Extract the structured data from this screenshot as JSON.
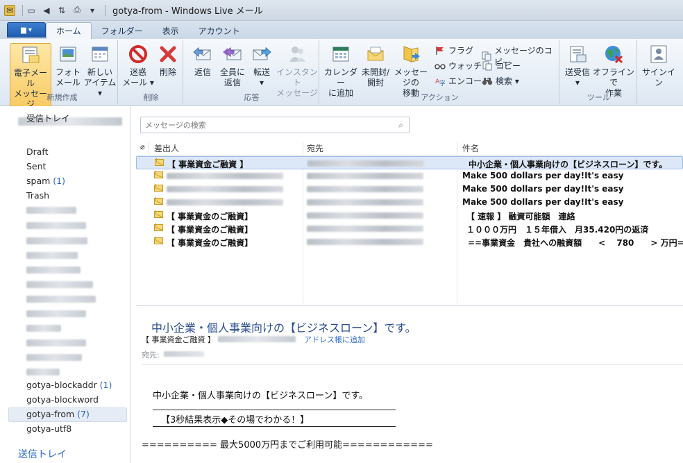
{
  "window": {
    "title": "gotya-from - Windows Live メール"
  },
  "tabs": {
    "file_label": "▆ ▾",
    "items": [
      "ホーム",
      "フォルダー",
      "表示",
      "アカウント"
    ]
  },
  "ribbon": {
    "groups": {
      "new": "新規作成",
      "delete": "削除",
      "respond": "応答",
      "actions": "アクション",
      "tools": "ツール"
    },
    "buttons": {
      "email_message": [
        "電子メール",
        "メッセージ"
      ],
      "photo_mail": [
        "フォト",
        "メール"
      ],
      "new_items": [
        "新しい",
        "アイテム ▾"
      ],
      "junk": [
        "迷惑",
        "メール ▾"
      ],
      "delete": "削除",
      "reply": "返信",
      "reply_all": [
        "全員に",
        "返信"
      ],
      "forward": [
        "転送",
        "▾"
      ],
      "instant_message": [
        "インスタント",
        "メッセージ"
      ],
      "add_to_calendar": [
        "カレンダー",
        "に追加"
      ],
      "unread_read": [
        "未開封/",
        "開封"
      ],
      "move_message": [
        "メッセージの",
        "移動"
      ],
      "flag": "フラグ",
      "watch": "ウォッチ",
      "encode": "エンコード",
      "copy_message": "メッセージのコピー",
      "copy": "コピー",
      "find": "検索 ▾",
      "send_receive": [
        "送受信",
        "▾"
      ],
      "work_offline": [
        "オフラインで",
        "作業"
      ],
      "sign_in": "サインイン"
    }
  },
  "folders": {
    "inbox": "受信トレイ",
    "draft": "Draft",
    "sent": "Sent",
    "spam": "spam",
    "spam_count": "(1)",
    "trash": "Trash",
    "blockaddr": "gotya-blockaddr",
    "blockaddr_count": "(1)",
    "blockword": "gotya-blockword",
    "from": "gotya-from",
    "from_count": "(7)",
    "utf8": "gotya-utf8",
    "outbox": "送信トレイ"
  },
  "search": {
    "placeholder": "メッセージの検索"
  },
  "list": {
    "headers": {
      "from": "差出人",
      "to": "宛先",
      "subject": "件名"
    },
    "rows": [
      {
        "from": "【 事業資金ご融資 】",
        "subject": "中小企業・個人事業向けの【ビジネスローン】です。"
      },
      {
        "from": "",
        "subject": "Make 500 dollars per day!It's easy"
      },
      {
        "from": "",
        "subject": "Make 500 dollars per day!It's easy"
      },
      {
        "from": "",
        "subject": "Make 500 dollars per day!It's easy"
      },
      {
        "from": "【 事業資金のご融資】",
        "subject": "【 速報 】 融資可能額　連絡"
      },
      {
        "from": "【 事業資金のご融資】",
        "subject": "１０００万円　１５年借入　月35.420円の返済"
      },
      {
        "from": "【 事業資金のご融資】",
        "subject": "==事業資金　貴社への融資額　　<　 780　　> 万円="
      }
    ]
  },
  "reading": {
    "subject": "中小企業・個人事業向けの【ビジネスローン】です。",
    "from": "【 事業資金ご融資 】",
    "add_to_address_book": "アドレス帳に追加",
    "to_label": "宛先:",
    "body_line1": "中小企業・個人事業向けの【ビジネスローン】です。",
    "body_line2": "【3秒結果表示◆その場でわかる！】",
    "body_line3": "========== 最大5000万円までご利用可能============"
  }
}
